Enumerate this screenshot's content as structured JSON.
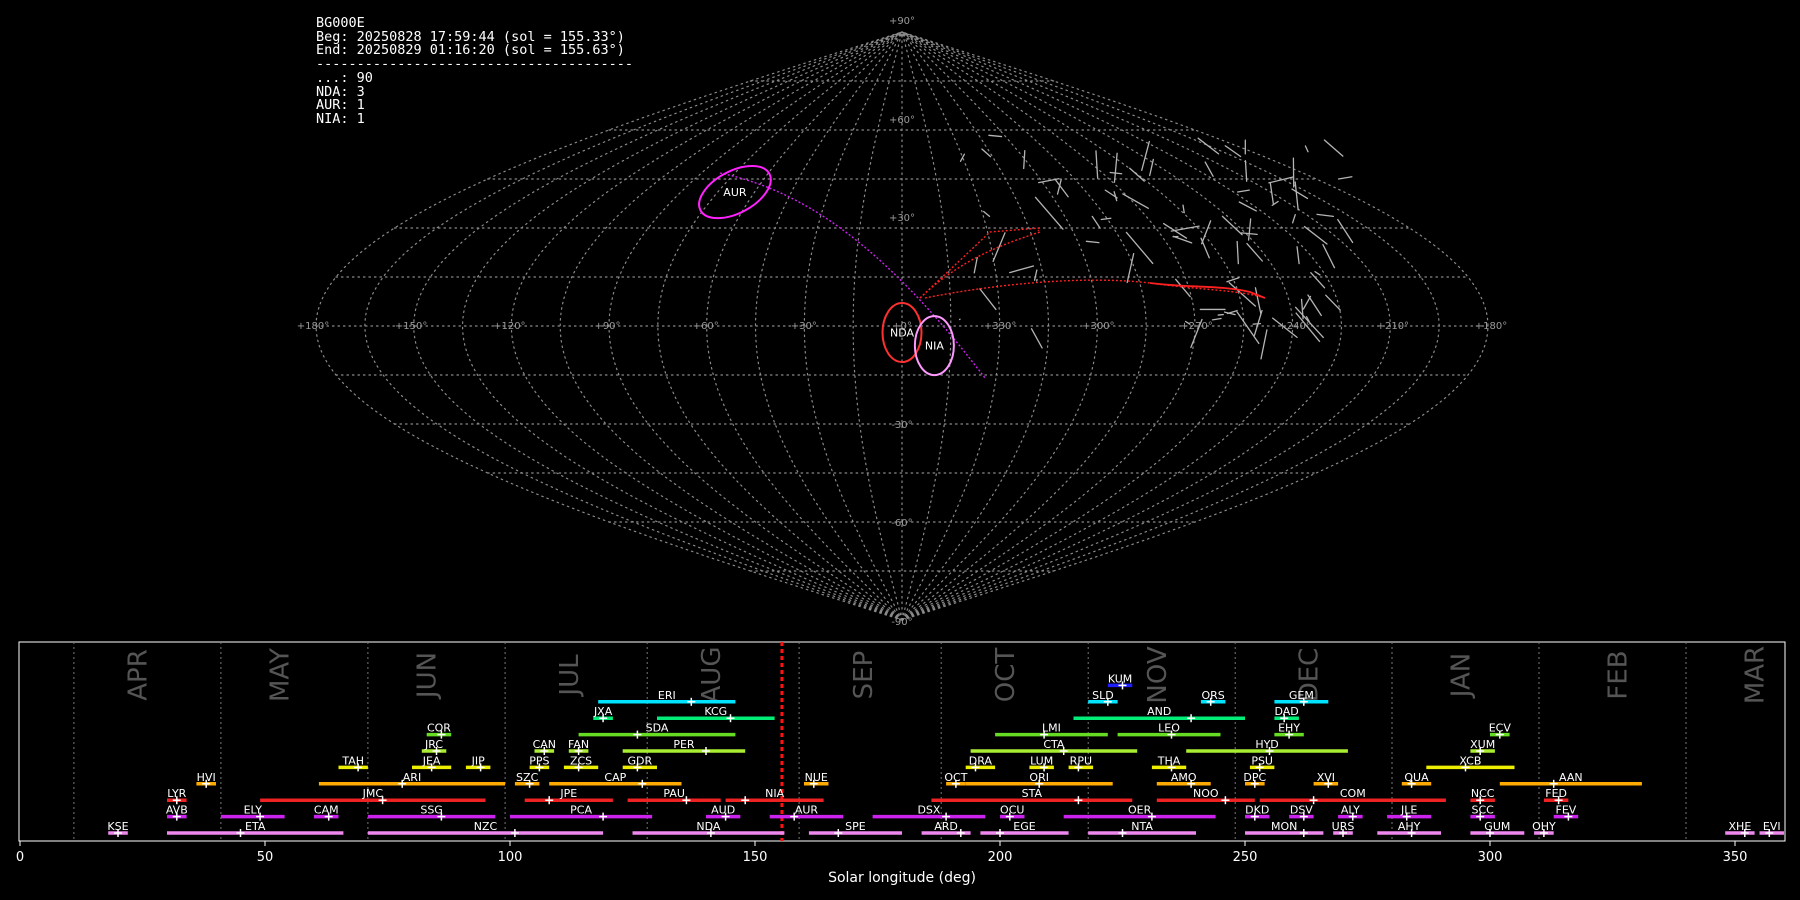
{
  "info": {
    "station": "BG000E",
    "begin": "Beg: 20250828 17:59:44 (sol = 155.33°)",
    "end": "End: 20250829 01:16:20 (sol = 155.63°)",
    "separator": "---------------------------------------",
    "counts": [
      "...: 90",
      "NDA: 3",
      "AUR: 1",
      "NIA: 1"
    ]
  },
  "colors": {
    "background": "#000000",
    "marker": "#ff0000",
    "grid": "#888888"
  },
  "sky_map": {
    "projection": "sinusoidal",
    "lon_labels": [
      "+180°",
      "+150°",
      "+120°",
      "+90°",
      "+60°",
      "+30°",
      "+0°",
      "+330°",
      "+300°",
      "+270°",
      "+240°",
      "+210°",
      "+180°"
    ],
    "lat_labels": [
      "+90°",
      "+60°",
      "+30°",
      "-30°",
      "-60°",
      "-90°"
    ],
    "radiants": [
      {
        "label": "AUR",
        "color": "#ff22ff",
        "ra": 68,
        "dec": 41,
        "a": 26,
        "b": 10
      },
      {
        "label": "NDA",
        "color": "#ff3030",
        "ra": 360,
        "dec": -2,
        "a": 13,
        "b": 13
      },
      {
        "label": "NIA",
        "color": "#ff99ff",
        "ra": 350,
        "dec": -6,
        "a": 13,
        "b": 13
      }
    ]
  },
  "chart_data": {
    "type": "timeline",
    "xlabel": "Solar longitude (deg)",
    "xlim": [
      0,
      360
    ],
    "xticks": [
      0,
      50,
      100,
      150,
      200,
      250,
      300,
      350
    ],
    "current_sol": 155.5,
    "month_boundaries": [
      11,
      41,
      71,
      99,
      128,
      159,
      188,
      218,
      248,
      280,
      310,
      340
    ],
    "month_labels": [
      {
        "name": "APR",
        "sol": 24
      },
      {
        "name": "MAY",
        "sol": 53
      },
      {
        "name": "JUN",
        "sol": 83
      },
      {
        "name": "JUL",
        "sol": 112
      },
      {
        "name": "AUG",
        "sol": 141
      },
      {
        "name": "SEP",
        "sol": 172
      },
      {
        "name": "OCT",
        "sol": 201
      },
      {
        "name": "NOV",
        "sol": 232
      },
      {
        "name": "DEC",
        "sol": 263
      },
      {
        "name": "JAN",
        "sol": 294
      },
      {
        "name": "FEB",
        "sol": 326
      },
      {
        "name": "MAR",
        "sol": 354
      }
    ],
    "showers": [
      {
        "code": "KUM",
        "start": 222,
        "end": 227,
        "peak": 225,
        "row": 9,
        "color": "#1e1eff"
      },
      {
        "code": "ERI",
        "start": 118,
        "end": 146,
        "peak": 137,
        "row": 8,
        "color": "#00e5ff"
      },
      {
        "code": "SLD",
        "start": 218,
        "end": 224,
        "peak": 222,
        "row": 8,
        "color": "#00e5ff"
      },
      {
        "code": "ORS",
        "start": 241,
        "end": 246,
        "peak": 243,
        "row": 8,
        "color": "#00e5ff"
      },
      {
        "code": "GEM",
        "start": 256,
        "end": 267,
        "peak": 262,
        "row": 8,
        "color": "#00e5ff"
      },
      {
        "code": "JXA",
        "start": 117,
        "end": 121,
        "peak": 119,
        "row": 7,
        "color": "#00ee77"
      },
      {
        "code": "KCG",
        "start": 130,
        "end": 154,
        "peak": 145,
        "row": 7,
        "color": "#00ee77"
      },
      {
        "code": "AND",
        "start": 215,
        "end": 250,
        "peak": 239,
        "row": 7,
        "color": "#00ee77"
      },
      {
        "code": "DAD",
        "start": 256,
        "end": 261,
        "peak": 258,
        "row": 7,
        "color": "#00ee77"
      },
      {
        "code": "COR",
        "start": 83,
        "end": 88,
        "peak": 86,
        "row": 6,
        "color": "#66dd22"
      },
      {
        "code": "SDA",
        "start": 114,
        "end": 146,
        "peak": 126,
        "row": 6,
        "color": "#66dd22"
      },
      {
        "code": "LMI",
        "start": 199,
        "end": 222,
        "peak": 209,
        "row": 6,
        "color": "#66dd22"
      },
      {
        "code": "LEO",
        "start": 224,
        "end": 245,
        "peak": 235,
        "row": 6,
        "color": "#66dd22"
      },
      {
        "code": "EHY",
        "start": 256,
        "end": 262,
        "peak": 259,
        "row": 6,
        "color": "#66dd22"
      },
      {
        "code": "ECV",
        "start": 300,
        "end": 304,
        "peak": 302,
        "row": 6,
        "color": "#66dd22"
      },
      {
        "code": "JRC",
        "start": 82,
        "end": 87,
        "peak": 85,
        "row": 5,
        "color": "#aaee33"
      },
      {
        "code": "CAN",
        "start": 105,
        "end": 109,
        "peak": 107,
        "row": 5,
        "color": "#aaee33"
      },
      {
        "code": "FAN",
        "start": 112,
        "end": 116,
        "peak": 114,
        "row": 5,
        "color": "#aaee33"
      },
      {
        "code": "PER",
        "start": 123,
        "end": 148,
        "peak": 140,
        "row": 5,
        "color": "#aaee33"
      },
      {
        "code": "CTA",
        "start": 194,
        "end": 228,
        "peak": 213,
        "row": 5,
        "color": "#aaee33"
      },
      {
        "code": "HYD",
        "start": 238,
        "end": 271,
        "peak": 255,
        "row": 5,
        "color": "#aaee33"
      },
      {
        "code": "XUM",
        "start": 296,
        "end": 301,
        "peak": 298,
        "row": 5,
        "color": "#aaee33"
      },
      {
        "code": "TAH",
        "start": 65,
        "end": 71,
        "peak": 69,
        "row": 4,
        "color": "#eeee00"
      },
      {
        "code": "JEA",
        "start": 80,
        "end": 88,
        "peak": 84,
        "row": 4,
        "color": "#eeee00"
      },
      {
        "code": "JIP",
        "start": 91,
        "end": 96,
        "peak": 94,
        "row": 4,
        "color": "#eeee00"
      },
      {
        "code": "PPS",
        "start": 104,
        "end": 108,
        "peak": 106,
        "row": 4,
        "color": "#eeee00"
      },
      {
        "code": "ZCS",
        "start": 111,
        "end": 118,
        "peak": 114,
        "row": 4,
        "color": "#eeee00"
      },
      {
        "code": "GDR",
        "start": 123,
        "end": 130,
        "peak": 126,
        "row": 4,
        "color": "#eeee00"
      },
      {
        "code": "DRA",
        "start": 193,
        "end": 199,
        "peak": 195,
        "row": 4,
        "color": "#eeee00"
      },
      {
        "code": "LUM",
        "start": 206,
        "end": 211,
        "peak": 209,
        "row": 4,
        "color": "#eeee00"
      },
      {
        "code": "RPU",
        "start": 214,
        "end": 219,
        "peak": 216,
        "row": 4,
        "color": "#eeee00"
      },
      {
        "code": "THA",
        "start": 231,
        "end": 238,
        "peak": 235,
        "row": 4,
        "color": "#eeee00"
      },
      {
        "code": "PSU",
        "start": 251,
        "end": 256,
        "peak": 253,
        "row": 4,
        "color": "#eeee00"
      },
      {
        "code": "XCB",
        "start": 287,
        "end": 305,
        "peak": 295,
        "row": 4,
        "color": "#eeee00"
      },
      {
        "code": "HVI",
        "start": 36,
        "end": 40,
        "peak": 38,
        "row": 3,
        "color": "#ffaa00"
      },
      {
        "code": "ARI",
        "start": 61,
        "end": 99,
        "peak": 78,
        "row": 3,
        "color": "#ffaa00"
      },
      {
        "code": "SZC",
        "start": 101,
        "end": 106,
        "peak": 104,
        "row": 3,
        "color": "#ffaa00"
      },
      {
        "code": "CAP",
        "start": 108,
        "end": 135,
        "peak": 127,
        "row": 3,
        "color": "#ffaa00"
      },
      {
        "code": "NUE",
        "start": 160,
        "end": 165,
        "peak": 162,
        "row": 3,
        "color": "#ffaa00"
      },
      {
        "code": "OCT",
        "start": 189,
        "end": 193,
        "peak": 191,
        "row": 3,
        "color": "#ffaa00"
      },
      {
        "code": "ORI",
        "start": 193,
        "end": 223,
        "peak": 208,
        "row": 3,
        "color": "#ffaa00"
      },
      {
        "code": "AMO",
        "start": 232,
        "end": 243,
        "peak": 239,
        "row": 3,
        "color": "#ffaa00"
      },
      {
        "code": "DPC",
        "start": 250,
        "end": 254,
        "peak": 252,
        "row": 3,
        "color": "#ffaa00"
      },
      {
        "code": "XVI",
        "start": 264,
        "end": 269,
        "peak": 267,
        "row": 3,
        "color": "#ffaa00"
      },
      {
        "code": "QUA",
        "start": 282,
        "end": 288,
        "peak": 284,
        "row": 3,
        "color": "#ffaa00"
      },
      {
        "code": "AAN",
        "start": 302,
        "end": 331,
        "peak": 313,
        "row": 3,
        "color": "#ffaa00"
      },
      {
        "code": "LYR",
        "start": 30,
        "end": 34,
        "peak": 32,
        "row": 2,
        "color": "#ee2222"
      },
      {
        "code": "JMC",
        "start": 49,
        "end": 95,
        "peak": 74,
        "row": 2,
        "color": "#ee2222"
      },
      {
        "code": "JPE",
        "start": 103,
        "end": 121,
        "peak": 108,
        "row": 2,
        "color": "#ee2222"
      },
      {
        "code": "PAU",
        "start": 124,
        "end": 143,
        "peak": 136,
        "row": 2,
        "color": "#ee2222"
      },
      {
        "code": "NIA",
        "start": 144,
        "end": 164,
        "peak": 148,
        "row": 2,
        "color": "#ee2222"
      },
      {
        "code": "STA",
        "start": 186,
        "end": 227,
        "peak": 216,
        "row": 2,
        "color": "#ee2222"
      },
      {
        "code": "NOO",
        "start": 232,
        "end": 252,
        "peak": 246,
        "row": 2,
        "color": "#ee2222"
      },
      {
        "code": "COM",
        "start": 253,
        "end": 291,
        "peak": 264,
        "row": 2,
        "color": "#ee2222"
      },
      {
        "code": "NCC",
        "start": 296,
        "end": 301,
        "peak": 298,
        "row": 2,
        "color": "#ee2222"
      },
      {
        "code": "FED",
        "start": 311,
        "end": 316,
        "peak": 314,
        "row": 2,
        "color": "#ee2222"
      },
      {
        "code": "AVB",
        "start": 30,
        "end": 34,
        "peak": 32,
        "row": 1,
        "color": "#cc22ee"
      },
      {
        "code": "ELY",
        "start": 41,
        "end": 54,
        "peak": 49,
        "row": 1,
        "color": "#cc22ee"
      },
      {
        "code": "CAM",
        "start": 60,
        "end": 65,
        "peak": 63,
        "row": 1,
        "color": "#cc22ee"
      },
      {
        "code": "SSG",
        "start": 71,
        "end": 97,
        "peak": 86,
        "row": 1,
        "color": "#cc22ee"
      },
      {
        "code": "PCA",
        "start": 100,
        "end": 129,
        "peak": 119,
        "row": 1,
        "color": "#cc22ee"
      },
      {
        "code": "AUD",
        "start": 140,
        "end": 147,
        "peak": 144,
        "row": 1,
        "color": "#cc22ee"
      },
      {
        "code": "AUR",
        "start": 153,
        "end": 168,
        "peak": 158,
        "row": 1,
        "color": "#cc22ee"
      },
      {
        "code": "DSX",
        "start": 174,
        "end": 197,
        "peak": 189,
        "row": 1,
        "color": "#cc22ee"
      },
      {
        "code": "OCU",
        "start": 200,
        "end": 205,
        "peak": 202,
        "row": 1,
        "color": "#cc22ee"
      },
      {
        "code": "OER",
        "start": 213,
        "end": 244,
        "peak": 231,
        "row": 1,
        "color": "#cc22ee"
      },
      {
        "code": "DKD",
        "start": 250,
        "end": 255,
        "peak": 252,
        "row": 1,
        "color": "#cc22ee"
      },
      {
        "code": "DSV",
        "start": 259,
        "end": 264,
        "peak": 262,
        "row": 1,
        "color": "#cc22ee"
      },
      {
        "code": "ALY",
        "start": 269,
        "end": 274,
        "peak": 272,
        "row": 1,
        "color": "#cc22ee"
      },
      {
        "code": "JLE",
        "start": 279,
        "end": 288,
        "peak": 283,
        "row": 1,
        "color": "#cc22ee"
      },
      {
        "code": "SCC",
        "start": 296,
        "end": 301,
        "peak": 298,
        "row": 1,
        "color": "#cc22ee"
      },
      {
        "code": "FEV",
        "start": 313,
        "end": 318,
        "peak": 316,
        "row": 1,
        "color": "#cc22ee"
      },
      {
        "code": "KSE",
        "start": 18,
        "end": 22,
        "peak": 20,
        "row": 0,
        "color": "#ee88ee"
      },
      {
        "code": "ETA",
        "start": 30,
        "end": 66,
        "peak": 45,
        "row": 0,
        "color": "#ee88ee"
      },
      {
        "code": "NZC",
        "start": 71,
        "end": 119,
        "peak": 101,
        "row": 0,
        "color": "#ee88ee"
      },
      {
        "code": "NDA",
        "start": 125,
        "end": 156,
        "peak": 141,
        "row": 0,
        "color": "#ee88ee"
      },
      {
        "code": "SPE",
        "start": 161,
        "end": 180,
        "peak": 167,
        "row": 0,
        "color": "#ee88ee"
      },
      {
        "code": "ARD",
        "start": 184,
        "end": 194,
        "peak": 192,
        "row": 0,
        "color": "#ee88ee"
      },
      {
        "code": "EGE",
        "start": 196,
        "end": 214,
        "peak": 200,
        "row": 0,
        "color": "#ee88ee"
      },
      {
        "code": "NTA",
        "start": 218,
        "end": 240,
        "peak": 225,
        "row": 0,
        "color": "#ee88ee"
      },
      {
        "code": "MON",
        "start": 250,
        "end": 266,
        "peak": 262,
        "row": 0,
        "color": "#ee88ee"
      },
      {
        "code": "URS",
        "start": 268,
        "end": 272,
        "peak": 270,
        "row": 0,
        "color": "#ee88ee"
      },
      {
        "code": "AHY",
        "start": 277,
        "end": 290,
        "peak": 284,
        "row": 0,
        "color": "#ee88ee"
      },
      {
        "code": "GUM",
        "start": 296,
        "end": 307,
        "peak": 300,
        "row": 0,
        "color": "#ee88ee"
      },
      {
        "code": "OHY",
        "start": 309,
        "end": 313,
        "peak": 311,
        "row": 0,
        "color": "#ee88ee"
      },
      {
        "code": "XHE",
        "start": 348,
        "end": 354,
        "peak": 352,
        "row": 0,
        "color": "#ee88ee"
      },
      {
        "code": "EVI",
        "start": 355,
        "end": 360,
        "peak": 357,
        "row": 0,
        "color": "#ee88ee"
      }
    ]
  }
}
